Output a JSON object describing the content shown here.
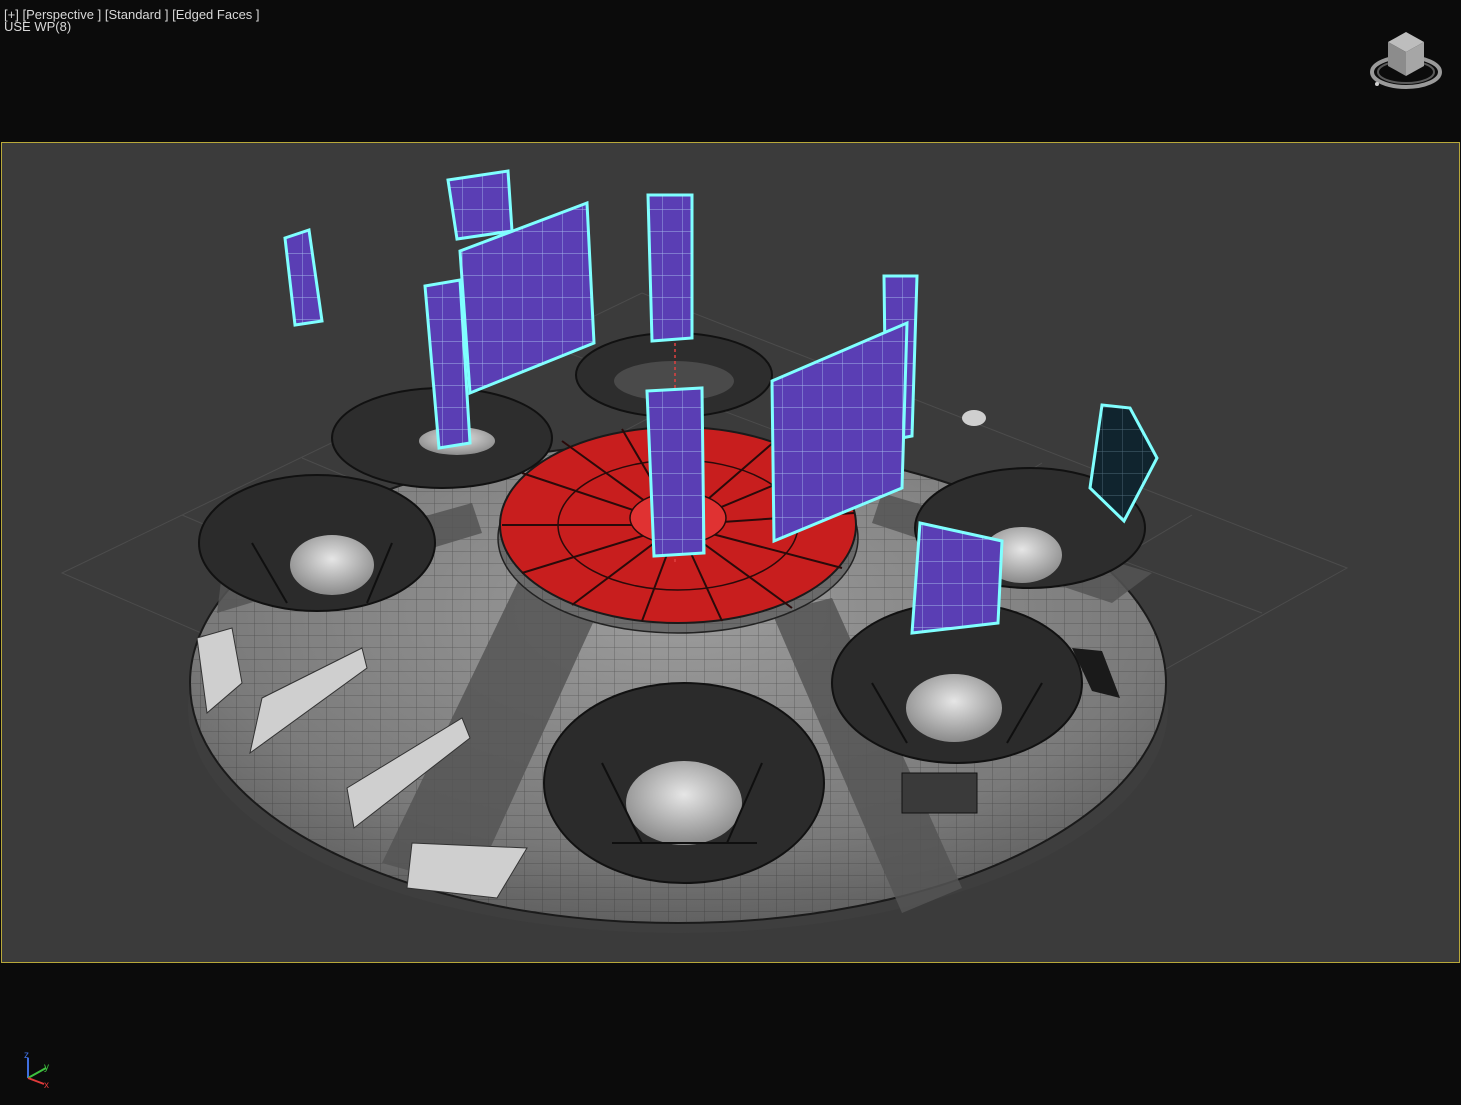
{
  "viewport": {
    "label_menu": "[+]",
    "label_view": "[Perspective ]",
    "label_shading": "[Standard ]",
    "label_display": "[Edged Faces ]",
    "workplane": "USE WP(8)"
  },
  "axis": {
    "z": "z",
    "y": "y",
    "x": "x"
  },
  "colors": {
    "background": "#0b0b0b",
    "viewport_bg": "#3b3b3b",
    "frame_border": "#b8a83a",
    "selection": "#7fffff",
    "panel_fill": "#5a3eb4",
    "center_red": "#c81e1e",
    "saucer_grey": "#8a8a8a"
  },
  "icons": [
    "viewcube-icon",
    "axis-tripod-icon"
  ]
}
